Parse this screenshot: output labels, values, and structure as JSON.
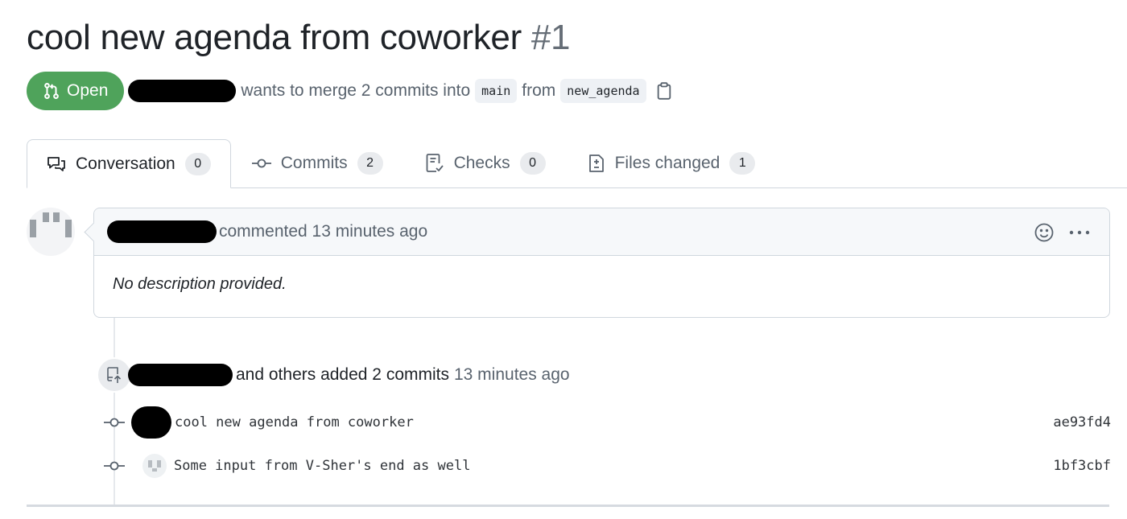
{
  "pr": {
    "title": "cool new agenda from coworker",
    "number": "#1",
    "state": "Open",
    "merge_text": "wants to merge 2 commits into",
    "base_branch": "main",
    "from_text": "from",
    "head_branch": "new_agenda"
  },
  "tabs": [
    {
      "label": "Conversation",
      "count": "0",
      "icon": "comment-discussion-icon"
    },
    {
      "label": "Commits",
      "count": "2",
      "icon": "git-commit-icon"
    },
    {
      "label": "Checks",
      "count": "0",
      "icon": "checklist-icon"
    },
    {
      "label": "Files changed",
      "count": "1",
      "icon": "file-diff-icon"
    }
  ],
  "comment": {
    "action": "commented 13 minutes ago",
    "body": "No description provided."
  },
  "push_event": {
    "text": "and others added 2 commits",
    "time": "13 minutes ago"
  },
  "commits": [
    {
      "message": "cool new agenda from coworker",
      "sha": "ae93fd4"
    },
    {
      "message": "Some input from V-Sher's end as well",
      "sha": "1bf3cbf"
    }
  ],
  "colors": {
    "open_badge": "#4fa35b",
    "muted_text": "#59636e",
    "border": "#d0d7de",
    "counter_bg": "#e9ebee"
  }
}
